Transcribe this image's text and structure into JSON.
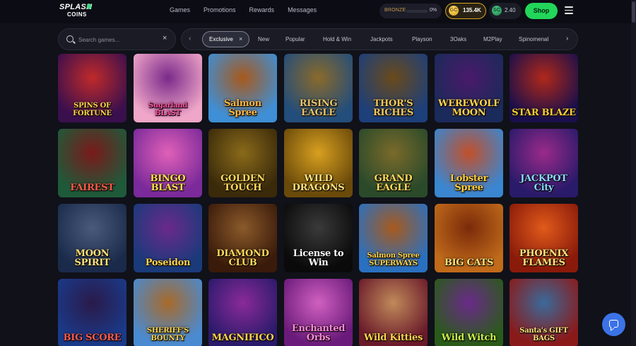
{
  "brand": {
    "line1": "SPLASH",
    "line2": "COINS"
  },
  "nav": [
    "Games",
    "Promotions",
    "Rewards",
    "Messages"
  ],
  "tier": {
    "label": "BRONZE",
    "progress_label": "0%",
    "progress": 0.0,
    "color": "#c89a4d"
  },
  "gold_coins": {
    "value": "135.4K",
    "icon": "gold-coin-icon",
    "symbol": "GC"
  },
  "sweeps_coins": {
    "value": "2.40",
    "icon": "sweeps-coin-icon",
    "symbol": "SC"
  },
  "shop_label": "Shop",
  "search": {
    "placeholder": "Search games..."
  },
  "filters": {
    "active": "Exclusive",
    "items": [
      "New",
      "Popular",
      "Hold & Win",
      "Jackpots",
      "Playson",
      "3Oaks",
      "M2Play",
      "Spinomenal"
    ]
  },
  "games": [
    {
      "title": "SPINS OF FORTUNE",
      "bg": [
        "#3a0f4d",
        "#c02a2a"
      ],
      "color": "#ffd54a"
    },
    {
      "title": "Sugarland BLAST",
      "bg": [
        "#f0a6c8",
        "#7a2a8a"
      ],
      "color": "#ff4fa0"
    },
    {
      "title": "Salmon Spree",
      "bg": [
        "#3e8fd6",
        "#a8591c"
      ],
      "color": "#ffb640"
    },
    {
      "title": "RISING EAGLE",
      "bg": [
        "#234d7a",
        "#8a6a2a"
      ],
      "color": "#e8c36a"
    },
    {
      "title": "THOR'S RICHES",
      "bg": [
        "#1d3f7a",
        "#6a4a1a"
      ],
      "color": "#f0c75a"
    },
    {
      "title": "WEREWOLF MOON",
      "bg": [
        "#1a2a5a",
        "#4a1a6a"
      ],
      "color": "#ffd34a"
    },
    {
      "title": "STAR BLAZE",
      "bg": [
        "#1a0f4a",
        "#b0281a"
      ],
      "color": "#ffcc33"
    },
    {
      "title": "FAIREST",
      "bg": [
        "#1e5a3a",
        "#7a1a1a"
      ],
      "color": "#ff5a4a"
    },
    {
      "title": "BINGO BLAST",
      "bg": [
        "#7a2a9a",
        "#e060b8"
      ],
      "color": "#ffe04a"
    },
    {
      "title": "GOLDEN TOUCH",
      "bg": [
        "#3a2a0a",
        "#8a6a1a"
      ],
      "color": "#ffd95a"
    },
    {
      "title": "WILD DRAGONS",
      "bg": [
        "#6a4a0a",
        "#d8a020"
      ],
      "color": "#ffe27a"
    },
    {
      "title": "GRAND EAGLE",
      "bg": [
        "#2a4a2a",
        "#7a6a2a"
      ],
      "color": "#ffd95a"
    },
    {
      "title": "Lobster Spree",
      "bg": [
        "#3a86d0",
        "#c2502a"
      ],
      "color": "#ffcf3a"
    },
    {
      "title": "JACKPOT City",
      "bg": [
        "#2a1a6a",
        "#9a2a8a"
      ],
      "color": "#8ad8ff"
    },
    {
      "title": "MOON SPIRIT",
      "bg": [
        "#1a2a4a",
        "#4a5a7a"
      ],
      "color": "#ffe27a"
    },
    {
      "title": "Poseidon",
      "bg": [
        "#1a3a7a",
        "#6a2a8a"
      ],
      "color": "#ffd34a"
    },
    {
      "title": "DIAMOND CLUB",
      "bg": [
        "#3a1a0a",
        "#8a5a2a"
      ],
      "color": "#ffd95a"
    },
    {
      "title": "License to Win",
      "bg": [
        "#0a0a0a",
        "#3a3a3a"
      ],
      "color": "#ffffff"
    },
    {
      "title": "Salmon Spree SUPERWAYS",
      "bg": [
        "#2a70c0",
        "#a85a1c"
      ],
      "color": "#ffd34a"
    },
    {
      "title": "BIG CATS",
      "bg": [
        "#c06a1a",
        "#7a2a0a"
      ],
      "color": "#ffe27a"
    },
    {
      "title": "PHOENIX FLAMES",
      "bg": [
        "#8a1a0a",
        "#e05a1a"
      ],
      "color": "#ffe27a"
    },
    {
      "title": "BIG SCORE",
      "bg": [
        "#1a3a8a",
        "#2a1a4a"
      ],
      "color": "#ff5a4a"
    },
    {
      "title": "SHERIFF'S BOUNTY",
      "bg": [
        "#4a8ad0",
        "#a86a2a"
      ],
      "color": "#ffd34a"
    },
    {
      "title": "MAGNIFICO",
      "bg": [
        "#2a1a6a",
        "#8a2a9a"
      ],
      "color": "#ffd34a"
    },
    {
      "title": "Enchanted Orbs",
      "bg": [
        "#6a1a7a",
        "#d060c0"
      ],
      "color": "#ff8ad8"
    },
    {
      "title": "Wild Kitties",
      "bg": [
        "#6a1a2a",
        "#c08a5a"
      ],
      "color": "#ffd34a"
    },
    {
      "title": "Wild Witch",
      "bg": [
        "#2a5a1a",
        "#6a2a8a"
      ],
      "color": "#c8f04a"
    },
    {
      "title": "Santa's GIFT BAGS",
      "bg": [
        "#8a1a1a",
        "#3a6a9a"
      ],
      "color": "#ffe27a"
    }
  ],
  "icons": {
    "search": "search-icon",
    "clear": "close-icon",
    "menu": "hamburger-menu-icon",
    "chat": "chat-bubble-icon",
    "prev": "chevron-left-icon",
    "next": "chevron-right-icon"
  }
}
